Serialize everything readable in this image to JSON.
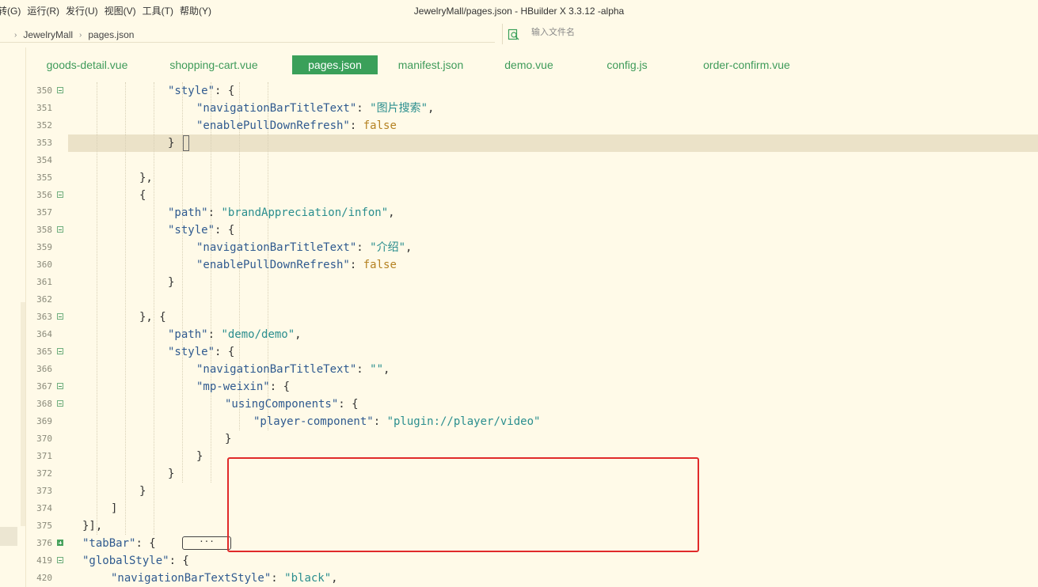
{
  "window": {
    "title": "JewelryMall/pages.json - HBuilder X 3.3.12 -alpha"
  },
  "menu": [
    "转(G)",
    "运行(R)",
    "发行(U)",
    "视图(V)",
    "工具(T)",
    "帮助(Y)"
  ],
  "breadcrumb": {
    "project": "JewelryMall",
    "file": "pages.json"
  },
  "file_search": {
    "placeholder": "输入文件名"
  },
  "tabs": [
    {
      "label": "goods-detail.vue",
      "active": false
    },
    {
      "label": "shopping-cart.vue",
      "active": false
    },
    {
      "label": "pages.json",
      "active": true
    },
    {
      "label": "manifest.json",
      "active": false
    },
    {
      "label": "demo.vue",
      "active": false
    },
    {
      "label": "config.js",
      "active": false
    },
    {
      "label": "order-confirm.vue",
      "active": false
    }
  ],
  "colors": {
    "background": "#fffae8",
    "tab_text": "#3e9b5a",
    "tab_active_bg": "#3aa05a",
    "json_key": "#2f5a8f",
    "json_string": "#2a8e8e",
    "json_bool": "#b58222",
    "current_line": "#ebe2c8",
    "annotation_box": "#e02a2a"
  },
  "editor": {
    "current_line": 353,
    "lines": [
      {
        "num": "350",
        "fold": "open",
        "tokens": [
          [
            "k",
            "\"style\""
          ],
          [
            "p",
            ": {"
          ]
        ]
      },
      {
        "num": "351",
        "fold": "none",
        "tokens": [
          [
            "k",
            "\"navigationBarTitleText\""
          ],
          [
            "p",
            ": "
          ],
          [
            "s",
            "\"图片搜索\""
          ],
          [
            "p",
            ","
          ]
        ]
      },
      {
        "num": "352",
        "fold": "none",
        "tokens": [
          [
            "k",
            "\"enablePullDownRefresh\""
          ],
          [
            "p",
            ": "
          ],
          [
            "b",
            "false"
          ]
        ]
      },
      {
        "num": "353",
        "fold": "none",
        "tokens": [
          [
            "p",
            "}"
          ]
        ]
      },
      {
        "num": "354",
        "fold": "none",
        "tokens": []
      },
      {
        "num": "355",
        "fold": "none",
        "tokens": [
          [
            "p",
            "},"
          ]
        ]
      },
      {
        "num": "356",
        "fold": "open",
        "tokens": [
          [
            "p",
            "{"
          ]
        ]
      },
      {
        "num": "357",
        "fold": "none",
        "tokens": [
          [
            "k",
            "\"path\""
          ],
          [
            "p",
            ": "
          ],
          [
            "s",
            "\"brandAppreciation/infon\""
          ],
          [
            "p",
            ","
          ]
        ]
      },
      {
        "num": "358",
        "fold": "open",
        "tokens": [
          [
            "k",
            "\"style\""
          ],
          [
            "p",
            ": {"
          ]
        ]
      },
      {
        "num": "359",
        "fold": "none",
        "tokens": [
          [
            "k",
            "\"navigationBarTitleText\""
          ],
          [
            "p",
            ": "
          ],
          [
            "s",
            "\"介绍\""
          ],
          [
            "p",
            ","
          ]
        ]
      },
      {
        "num": "360",
        "fold": "none",
        "tokens": [
          [
            "k",
            "\"enablePullDownRefresh\""
          ],
          [
            "p",
            ": "
          ],
          [
            "b",
            "false"
          ]
        ]
      },
      {
        "num": "361",
        "fold": "none",
        "tokens": [
          [
            "p",
            "}"
          ]
        ]
      },
      {
        "num": "362",
        "fold": "none",
        "tokens": []
      },
      {
        "num": "363",
        "fold": "open",
        "tokens": [
          [
            "p",
            "}, {"
          ]
        ]
      },
      {
        "num": "364",
        "fold": "none",
        "tokens": [
          [
            "k",
            "\"path\""
          ],
          [
            "p",
            ": "
          ],
          [
            "s",
            "\"demo/demo\""
          ],
          [
            "p",
            ","
          ]
        ]
      },
      {
        "num": "365",
        "fold": "open",
        "tokens": [
          [
            "k",
            "\"style\""
          ],
          [
            "p",
            ": {"
          ]
        ]
      },
      {
        "num": "366",
        "fold": "none",
        "tokens": [
          [
            "k",
            "\"navigationBarTitleText\""
          ],
          [
            "p",
            ": "
          ],
          [
            "s",
            "\"\""
          ],
          [
            "p",
            ","
          ]
        ]
      },
      {
        "num": "367",
        "fold": "open",
        "tokens": [
          [
            "k",
            "\"mp-weixin\""
          ],
          [
            "p",
            ": {"
          ]
        ]
      },
      {
        "num": "368",
        "fold": "open",
        "tokens": [
          [
            "k",
            "\"usingComponents\""
          ],
          [
            "p",
            ": {"
          ]
        ]
      },
      {
        "num": "369",
        "fold": "none",
        "tokens": [
          [
            "k",
            "\"player-component\""
          ],
          [
            "p",
            ": "
          ],
          [
            "s",
            "\"plugin://player/video\""
          ]
        ]
      },
      {
        "num": "370",
        "fold": "none",
        "tokens": [
          [
            "p",
            "}"
          ]
        ]
      },
      {
        "num": "371",
        "fold": "none",
        "tokens": [
          [
            "p",
            "}"
          ]
        ]
      },
      {
        "num": "372",
        "fold": "none",
        "tokens": [
          [
            "p",
            "}"
          ]
        ]
      },
      {
        "num": "373",
        "fold": "none",
        "tokens": [
          [
            "p",
            "}"
          ]
        ]
      },
      {
        "num": "374",
        "fold": "none",
        "tokens": [
          [
            "p",
            "]"
          ]
        ]
      },
      {
        "num": "375",
        "fold": "none",
        "tokens": [
          [
            "p",
            "}],"
          ]
        ]
      },
      {
        "num": "376",
        "fold": "closed",
        "tokens": [
          [
            "k",
            "\"tabBar\""
          ],
          [
            "p",
            ": { "
          ]
        ]
      },
      {
        "num": "419",
        "fold": "open",
        "tokens": [
          [
            "k",
            "\"globalStyle\""
          ],
          [
            "p",
            ": {"
          ]
        ]
      },
      {
        "num": "420",
        "fold": "none",
        "tokens": [
          [
            "k",
            "\"navigationBarTextStyle\""
          ],
          [
            "p",
            ": "
          ],
          [
            "s",
            "\"black\""
          ],
          [
            "p",
            ","
          ]
        ]
      }
    ],
    "collapsed_placeholder": "···"
  }
}
